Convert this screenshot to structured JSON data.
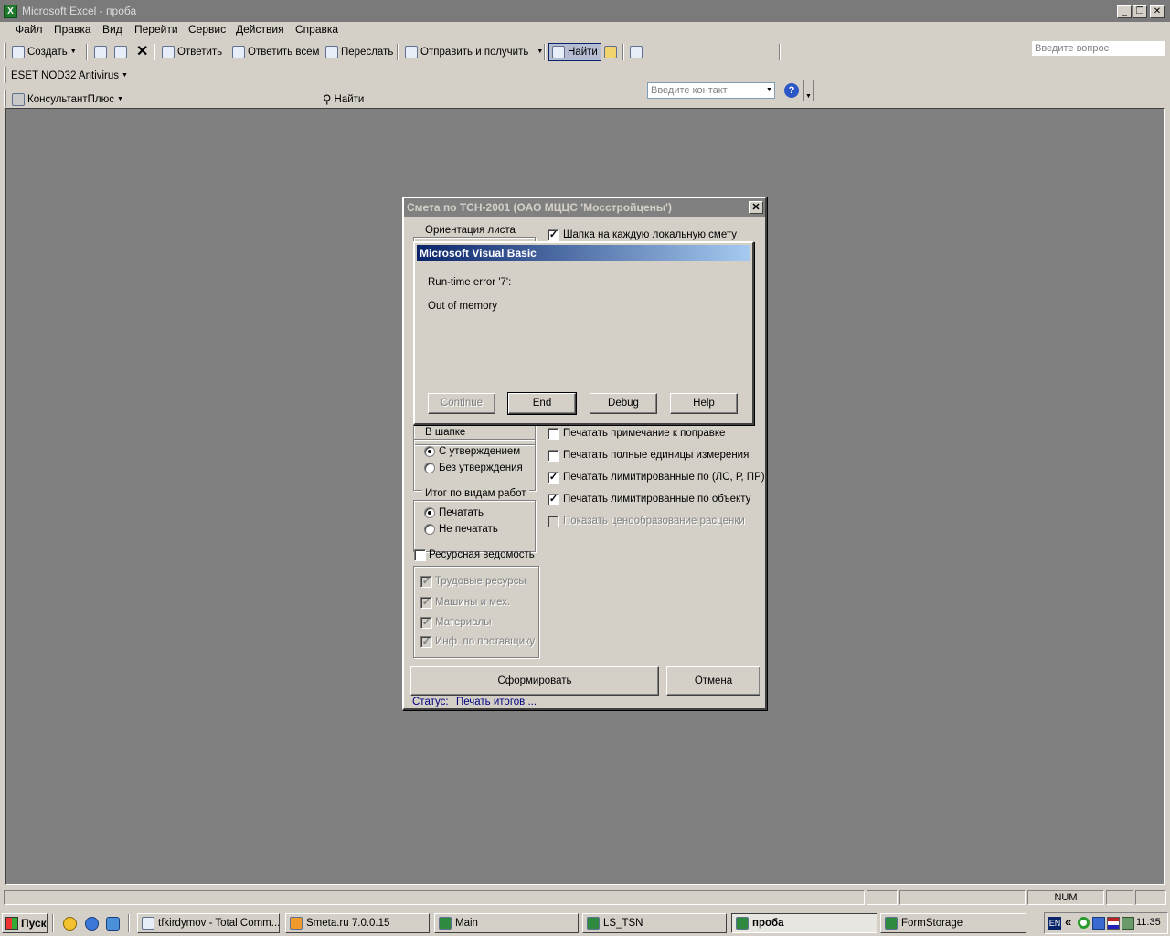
{
  "window": {
    "title": "Microsoft Excel - проба",
    "app_icon": "X"
  },
  "menu": [
    "Файл",
    "Правка",
    "Вид",
    "Перейти",
    "Сервис",
    "Действия",
    "Справка"
  ],
  "ask_placeholder": "Введите вопрос",
  "toolbar1": {
    "create": "Создать",
    "reply": "Ответить",
    "reply_all": "Ответить всем",
    "forward": "Переслать",
    "send_receive": "Отправить и получить",
    "find": "Найти",
    "contact_placeholder": "Введите контакт"
  },
  "toolbar2": {
    "eset": "ESET NOD32 Antivirus"
  },
  "toolbar3": {
    "consultant": "КонсультантПлюс",
    "find": "Найти"
  },
  "dialog": {
    "title": "Смета по ТСН-2001 (ОАО МЦЦС 'Мосстройцены')",
    "orientation_group": "Ориентация листа",
    "header_each_local": "Шапка на каждую локальную смету",
    "header_group": "В шапке",
    "header_with_approval": "С утверждением",
    "header_without_approval": "Без утверждения",
    "totals_group": "Итог по видам работ",
    "totals_print": "Печатать",
    "totals_noprint": "Не печатать",
    "resource_sheet": "Ресурсная ведомость",
    "labor": "Трудовые ресурсы",
    "machines": "Машины и мех.",
    "materials": "Материалы",
    "supplier_info": "Инф. по поставщику",
    "print_note": "Печатать примечание к поправке",
    "print_full_units": "Печатать полные единицы измерения",
    "print_limited_lsrpr": "Печатать лимитированные по (ЛС, Р, ПР)",
    "print_limited_object": "Печатать лимитированные по объекту",
    "show_pricing": "Показать ценообразование расценки",
    "generate": "Сформировать",
    "cancel": "Отмена",
    "status_label": "Статус:",
    "status_value": "Печать итогов ..."
  },
  "vb_error": {
    "title": "Microsoft Visual Basic",
    "error": "Run-time error '7':",
    "message": "Out of memory",
    "continue": "Continue",
    "end": "End",
    "debug": "Debug",
    "help": "Help"
  },
  "statusbar": {
    "num": "NUM"
  },
  "taskbar": {
    "start": "Пуск",
    "tasks": [
      "tfkirdymov - Total Comm...",
      "Smeta.ru  7.0.0.15",
      "Main",
      "LS_TSN",
      "проба",
      "FormStorage"
    ],
    "lang": "EN",
    "clock": "11:35"
  }
}
